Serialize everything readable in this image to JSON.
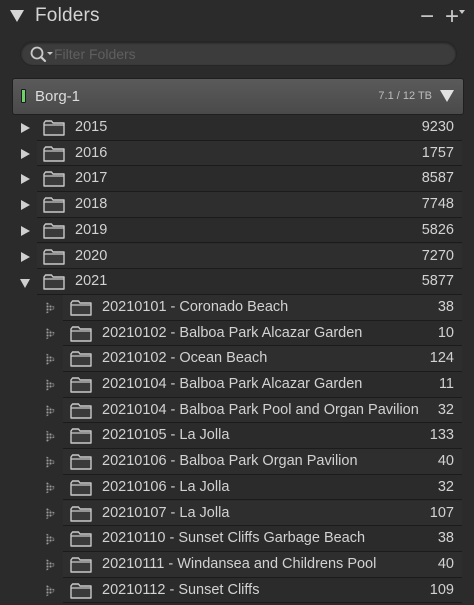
{
  "panel": {
    "title": "Folders",
    "minus_label": "−",
    "plus_label": "+"
  },
  "search": {
    "placeholder": "Filter Folders",
    "value": ""
  },
  "volume": {
    "name": "Borg-1",
    "usage": "7.1 / 12 TB",
    "status_color": "#6fd06b"
  },
  "folders": [
    {
      "name": "2015",
      "count": "9230",
      "level": 0,
      "expanded": false
    },
    {
      "name": "2016",
      "count": "1757",
      "level": 0,
      "expanded": false
    },
    {
      "name": "2017",
      "count": "8587",
      "level": 0,
      "expanded": false
    },
    {
      "name": "2018",
      "count": "7748",
      "level": 0,
      "expanded": false
    },
    {
      "name": "2019",
      "count": "5826",
      "level": 0,
      "expanded": false
    },
    {
      "name": "2020",
      "count": "7270",
      "level": 0,
      "expanded": false
    },
    {
      "name": "2021",
      "count": "5877",
      "level": 0,
      "expanded": true
    },
    {
      "name": "20210101 - Coronado Beach",
      "count": "38",
      "level": 1
    },
    {
      "name": "20210102 - Balboa Park Alcazar Garden",
      "count": "10",
      "level": 1
    },
    {
      "name": "20210102 - Ocean Beach",
      "count": "124",
      "level": 1
    },
    {
      "name": "20210104 - Balboa Park Alcazar Garden",
      "count": "11",
      "level": 1
    },
    {
      "name": "20210104 - Balboa Park Pool and Organ Pavilion",
      "count": "32",
      "level": 1
    },
    {
      "name": "20210105 - La Jolla",
      "count": "133",
      "level": 1
    },
    {
      "name": "20210106 - Balboa Park Organ Pavilion",
      "count": "40",
      "level": 1
    },
    {
      "name": "20210106 - La Jolla",
      "count": "32",
      "level": 1
    },
    {
      "name": "20210107 - La Jolla",
      "count": "107",
      "level": 1
    },
    {
      "name": "20210110 - Sunset Cliffs Garbage Beach",
      "count": "38",
      "level": 1
    },
    {
      "name": "20210111 - Windansea and Childrens Pool",
      "count": "40",
      "level": 1
    },
    {
      "name": "20210112 - Sunset Cliffs",
      "count": "109",
      "level": 1
    }
  ]
}
